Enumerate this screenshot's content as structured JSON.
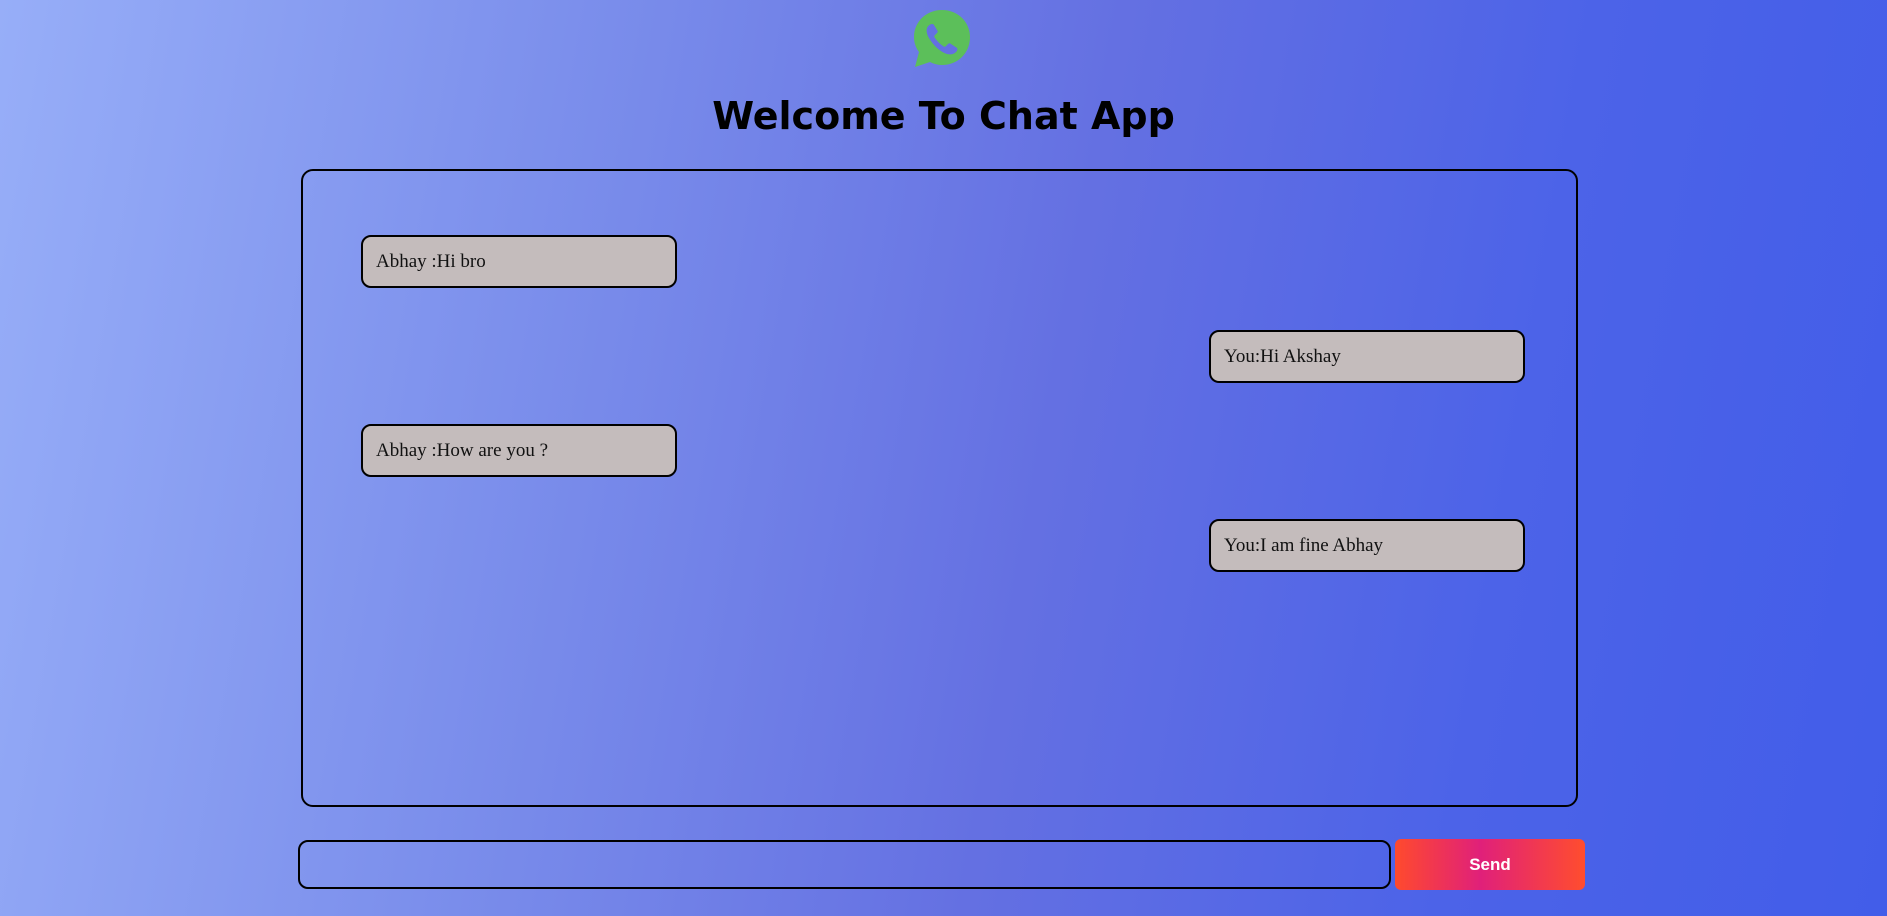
{
  "header": {
    "logo_icon": "whatsapp-icon",
    "title": "Welcome To Chat App"
  },
  "chat": {
    "messages": [
      {
        "side": "left",
        "text": "Abhay :Hi bro"
      },
      {
        "side": "right",
        "text": "You:Hi Akshay"
      },
      {
        "side": "left",
        "text": "Abhay :How are you ?"
      },
      {
        "side": "right",
        "text": "You:I am fine Abhay"
      }
    ]
  },
  "composer": {
    "value": "",
    "placeholder": "",
    "send_label": "Send"
  },
  "colors": {
    "bubble": "#c4bcbc",
    "logo_green": "#5cbf5a",
    "send_gradient_start": "#ff4a2d",
    "send_gradient_mid": "#e0207a"
  }
}
